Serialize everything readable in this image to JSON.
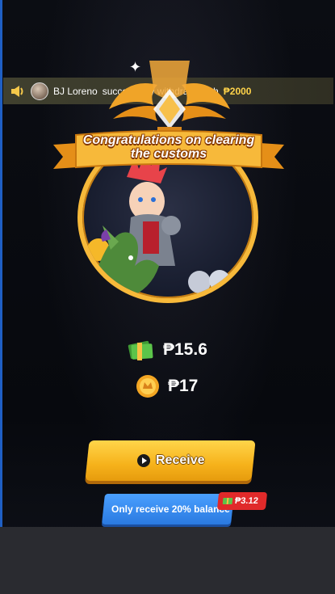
{
  "ticker": {
    "user_name": "BJ Loreno",
    "message": "successfully withdraw cash",
    "amount": "₱2000"
  },
  "banner": {
    "title_line1": "Congratulations on clearing",
    "title_line2": "the customs"
  },
  "rewards": {
    "cash": "₱15.6",
    "coins": "₱17"
  },
  "buttons": {
    "receive_label": "Receive",
    "only_receive_label": "Only receive 20% balance",
    "badge_value": "₱3.12"
  },
  "colors": {
    "accent_gold": "#f6b21b",
    "secondary_blue": "#2a7ae0",
    "badge_red": "#e02a2a",
    "amount_yellow": "#ffd34a"
  },
  "icons": [
    "speaker-icon",
    "avatar",
    "sparkle-icon",
    "trophy-icon",
    "cash-stack-icon",
    "coin-icon",
    "play-icon",
    "cash-badge-icon"
  ]
}
